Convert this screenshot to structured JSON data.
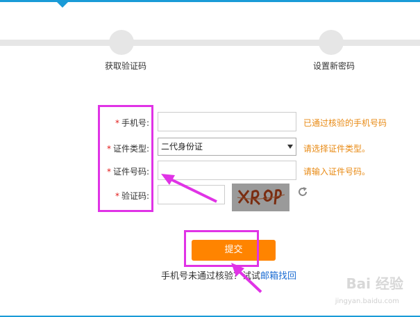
{
  "steps": [
    {
      "label": "获取验证码"
    },
    {
      "label": "设置新密码"
    }
  ],
  "form": {
    "phone": {
      "label": "手机号:",
      "value": "",
      "hint": "已通过核验的手机号码"
    },
    "id_type": {
      "label": "证件类型:",
      "selected": "二代身份证",
      "hint": "请选择证件类型。"
    },
    "id_number": {
      "label": "证件号码:",
      "value": "",
      "hint": "请输入证件号码。"
    },
    "captcha": {
      "label": "验证码:",
      "value": "",
      "image_text": "XRQP"
    }
  },
  "required_mark": "*",
  "submit_label": "提交",
  "footer": {
    "text": "手机号未通过核验？试试",
    "link": "邮箱找回"
  },
  "watermark": {
    "main": "Bai 经验",
    "sub": "jingyan.baidu.com"
  },
  "colors": {
    "accent": "#1a9bd7",
    "submit": "#ff8400",
    "hint": "#e88a14",
    "required": "#e21918",
    "annotation": "#e033e6",
    "link": "#1c6dd3"
  }
}
